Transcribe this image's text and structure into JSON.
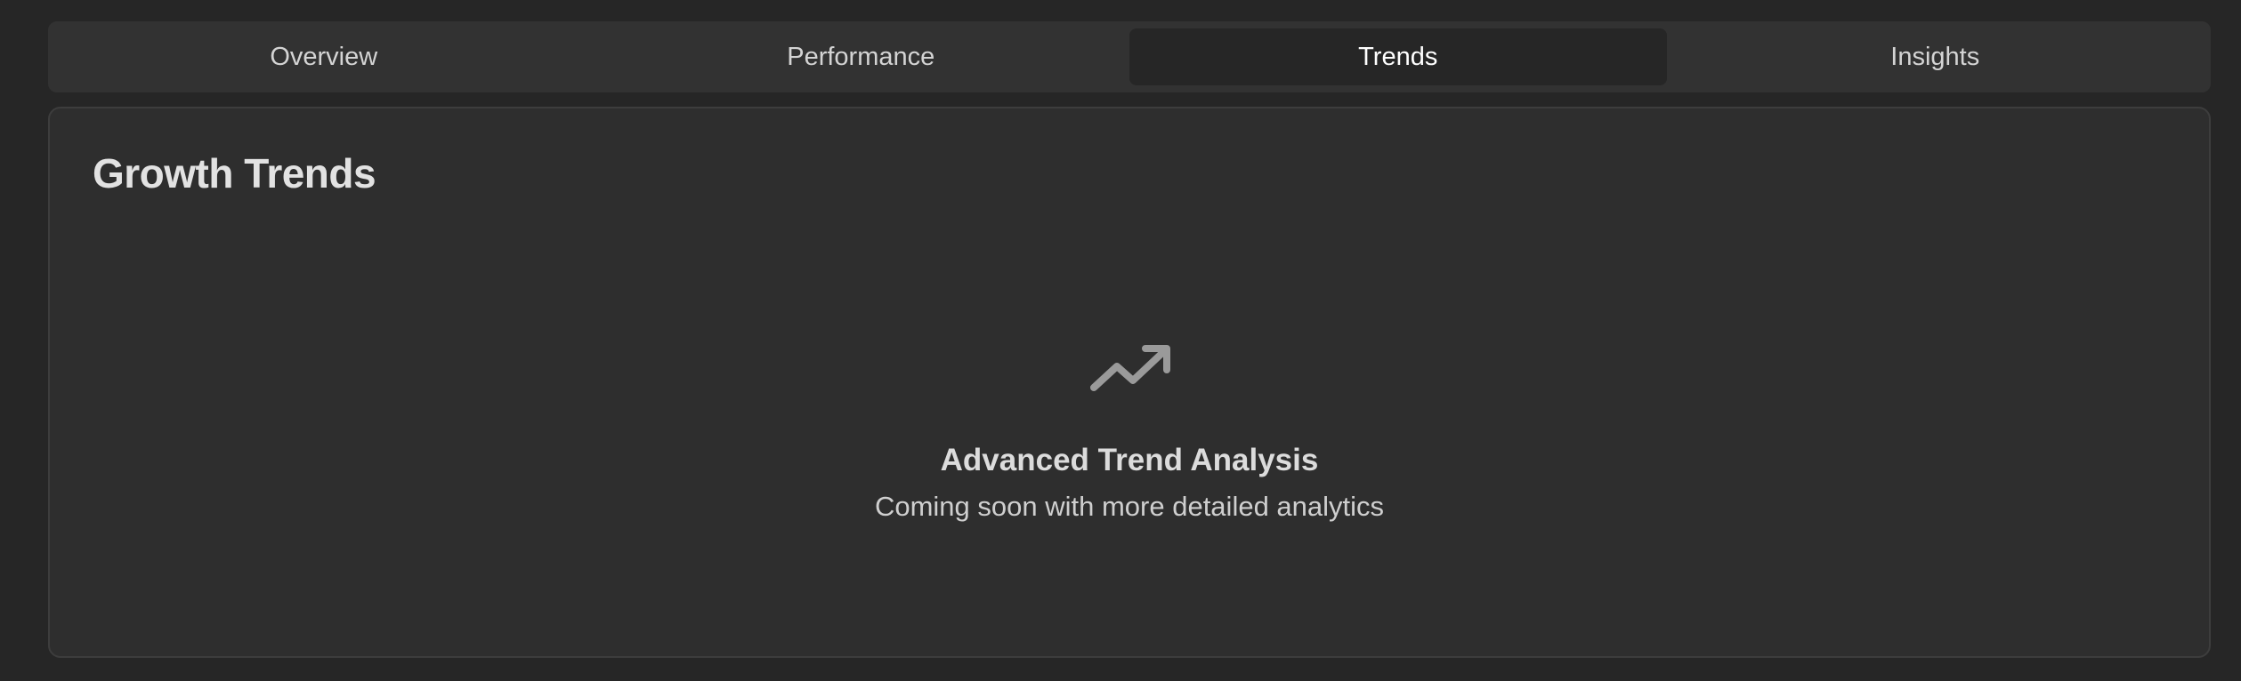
{
  "tabs": [
    {
      "label": "Overview",
      "active": false
    },
    {
      "label": "Performance",
      "active": false
    },
    {
      "label": "Trends",
      "active": true
    },
    {
      "label": "Insights",
      "active": false
    }
  ],
  "card": {
    "title": "Growth Trends",
    "empty_state": {
      "icon": "trending-up-icon",
      "title": "Advanced Trend Analysis",
      "subtitle": "Coming soon with more detailed analytics"
    }
  },
  "colors": {
    "page_background": "#262626",
    "tabbar_background": "#323232",
    "active_tab_background": "#262626",
    "card_background": "#2e2e2e",
    "icon": "#9a9a9a"
  }
}
